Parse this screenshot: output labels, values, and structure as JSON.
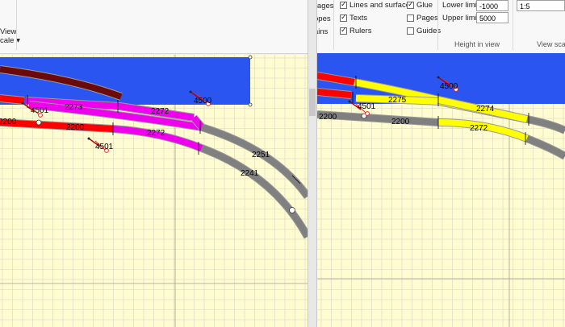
{
  "left_ribbon": {
    "view_scale_label_1": "View",
    "view_scale_label_2": "cale ▾"
  },
  "right_ribbon": {
    "col1": [
      "ntages",
      "opes",
      "ains"
    ],
    "col2": [
      {
        "label": "Lines and surfaces",
        "checked": true
      },
      {
        "label": "Texts",
        "checked": true
      },
      {
        "label": "Rulers",
        "checked": true
      }
    ],
    "col3": [
      {
        "label": "Glue",
        "checked": true
      },
      {
        "label": "Pages",
        "checked": false
      },
      {
        "label": "Guides",
        "checked": false
      }
    ],
    "height_in_view": {
      "lower_label": "Lower limit",
      "lower_value": "-1000",
      "upper_label": "Upper limit",
      "upper_value": "5000",
      "group_label": "Height in view"
    },
    "view_scale": {
      "value": "1:5",
      "group_label": "View scale"
    }
  },
  "left_tracks": {
    "labels": [
      "4501",
      "2273",
      "2272",
      "2200",
      "2200",
      "2272",
      "4501",
      "4500",
      "2251",
      "2241"
    ]
  },
  "right_tracks": {
    "labels": [
      "4500",
      "4501",
      "2275",
      "2274",
      "2200",
      "2200",
      "2272"
    ]
  },
  "colors": {
    "canvas_bg": "#fffcd1",
    "grid": "#d6d6c4",
    "selection": "#2b55f0",
    "track_red": "#ff0000",
    "track_magenta": "#ee00ee",
    "track_yellow": "#ffff00",
    "track_gray": "#808080",
    "track_darkred": "#6b0a0a"
  }
}
